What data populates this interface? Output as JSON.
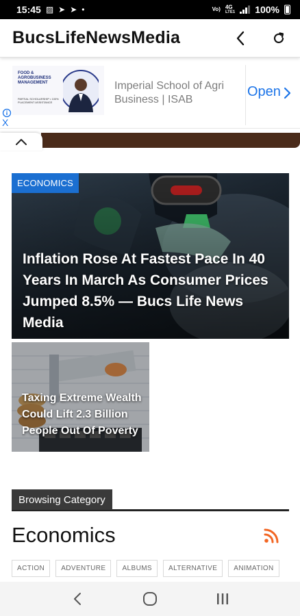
{
  "status_bar": {
    "time": "15:45",
    "network": "4G",
    "network_sub": "LTE1",
    "volte": "Vo)",
    "battery": "100%",
    "icons": [
      "image-icon",
      "telegram-icon",
      "telegram-icon",
      "dot-icon",
      "wifi-calling-icon",
      "signal-icon",
      "battery-icon"
    ]
  },
  "app_bar": {
    "title": "BucsLifeNewsMedia",
    "back_icon": "chevron-left-icon",
    "refresh_icon": "refresh-icon"
  },
  "ad": {
    "image_heading": "FOOD & AGROBUSINESS MANAGEMENT",
    "image_sub": "PARTIAL SCHOLARSHIP • 100% PLACEMENT ASSISTANCE",
    "advertiser": "Imperial School of Agri Business | ISAB",
    "cta": "Open",
    "close": "X"
  },
  "featured": {
    "category": "ECONOMICS",
    "title": "Inflation Rose At Fastest Pace In 40 Years In March As Consumer Prices Jumped 8.5% — Bucs Life News Media"
  },
  "secondary": {
    "title": "Taxing Extreme Wealth Could Lift 2.3 Billion People Out Of Poverty"
  },
  "browsing": {
    "label": "Browsing Category",
    "category": "Economics"
  },
  "tags": [
    "ACTION",
    "ADVENTURE",
    "ALBUMS",
    "ALTERNATIVE",
    "ANIMATION"
  ],
  "colors": {
    "accent_blue": "#1b6fd1",
    "rss_orange": "#f26522",
    "ad_blue": "#1a73e8"
  }
}
